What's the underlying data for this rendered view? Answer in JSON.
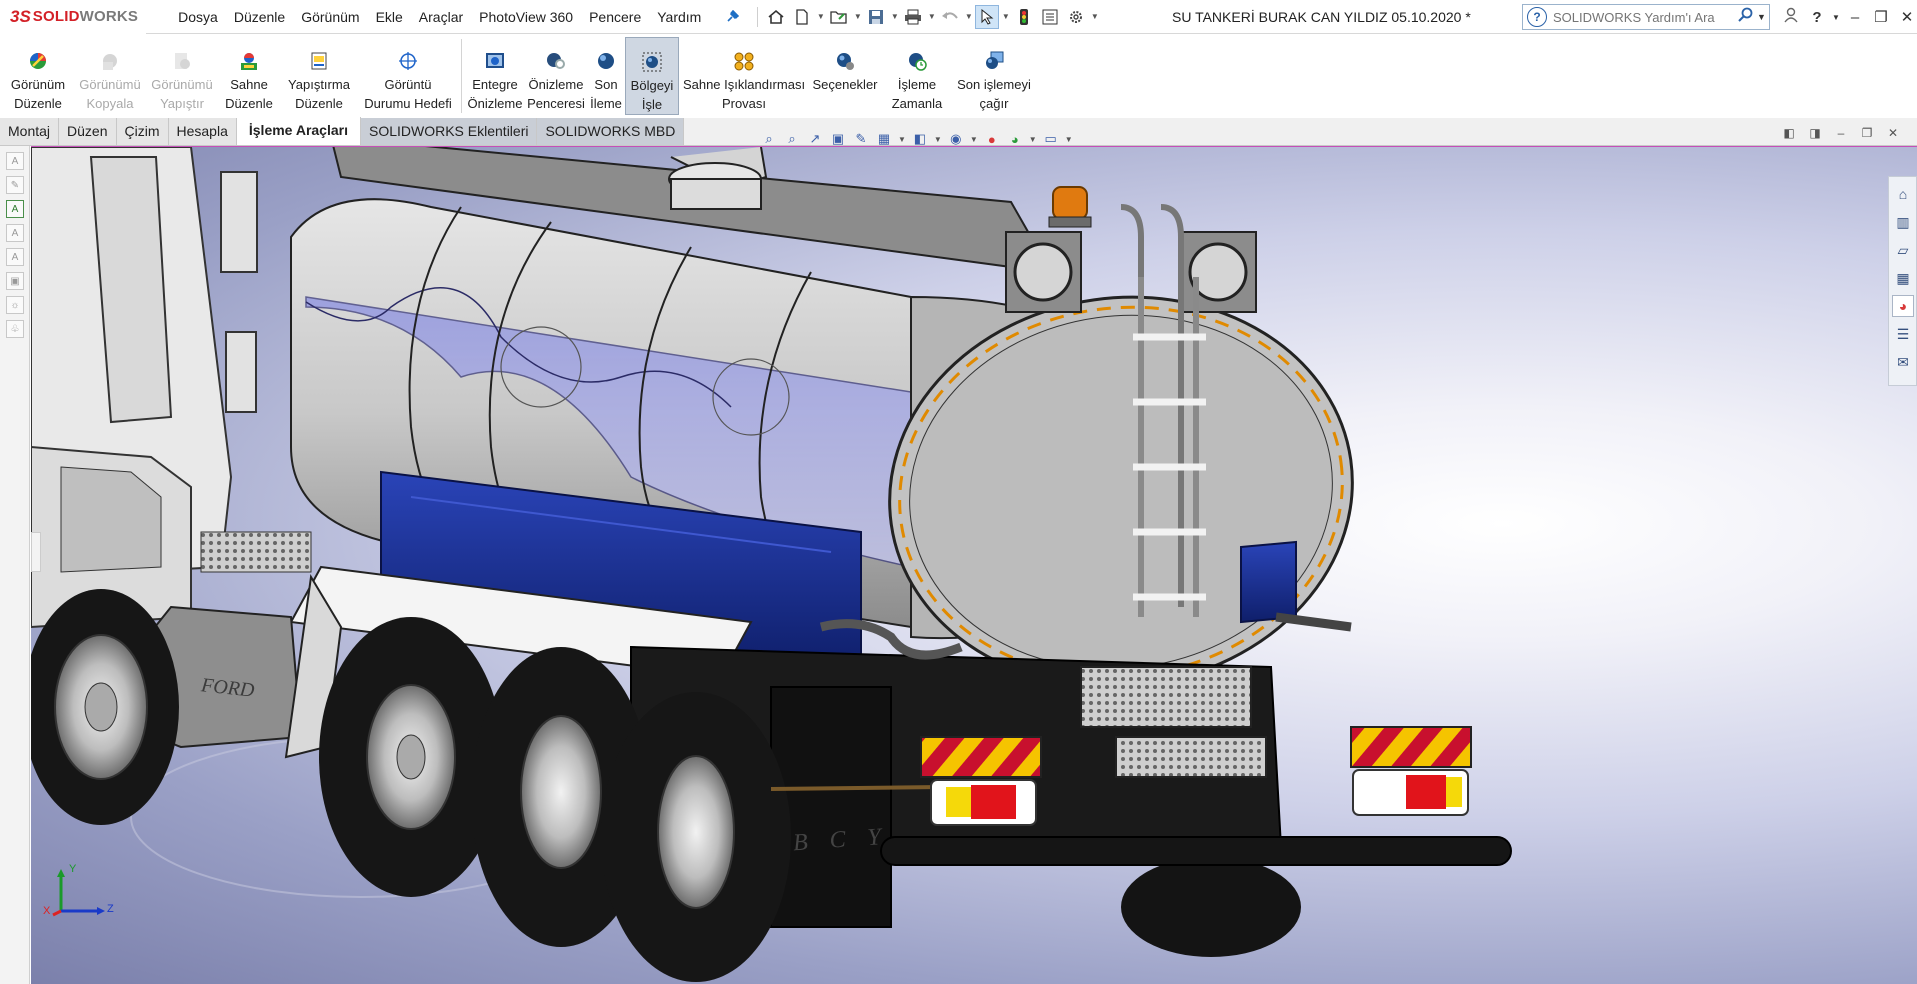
{
  "app": {
    "logo_ds": "3S",
    "logo_solid": "SOLID",
    "logo_works": "WORKS",
    "document_title": "SU TANKERİ BURAK CAN YILDIZ 05.10.2020 *"
  },
  "menu": [
    "Dosya",
    "Düzenle",
    "Görünüm",
    "Ekle",
    "Araçlar",
    "PhotoView 360",
    "Pencere",
    "Yardım"
  ],
  "search": {
    "placeholder": "SOLIDWORKS Yardım'ı Ara"
  },
  "ribbon": {
    "buttons": [
      {
        "line1": "Görünüm",
        "line2": "Düzenle"
      },
      {
        "line1": "Görünümü",
        "line2": "Kopyala"
      },
      {
        "line1": "Görünümü",
        "line2": "Yapıştır"
      },
      {
        "line1": "Sahne",
        "line2": "Düzenle"
      },
      {
        "line1": "Yapıştırma",
        "line2": "Düzenle"
      },
      {
        "line1": "Görüntü",
        "line2": "Durumu Hedefi"
      },
      {
        "line1": "Entegre",
        "line2": "Önizleme"
      },
      {
        "line1": "Önizleme",
        "line2": "Penceresi"
      },
      {
        "line1": "Son",
        "line2": "İleme"
      },
      {
        "line1": "Bölgeyi",
        "line2": "İşle"
      },
      {
        "line1": "Sahne Işıklandırması",
        "line2": "Provası"
      },
      {
        "line1": "Seçenekler",
        "line2": ""
      },
      {
        "line1": "İşleme",
        "line2": "Zamanla"
      },
      {
        "line1": "Son işlemeyi",
        "line2": "çağır"
      }
    ]
  },
  "tabs": [
    "Montaj",
    "Düzen",
    "Çizim",
    "Hesapla",
    "İşleme Araçları",
    "SOLIDWORKS Eklentileri",
    "SOLIDWORKS MBD"
  ],
  "model": {
    "emboss_brand": "FORD",
    "emboss_initials": "B C Y"
  },
  "triad": {
    "x": "X",
    "y": "Y",
    "z": "Z"
  },
  "colors": {
    "accent_blue": "#1f3fa0",
    "tank_gray": "#c9c9c9",
    "warning_red": "#c8102e",
    "warning_yellow": "#f5c400"
  }
}
